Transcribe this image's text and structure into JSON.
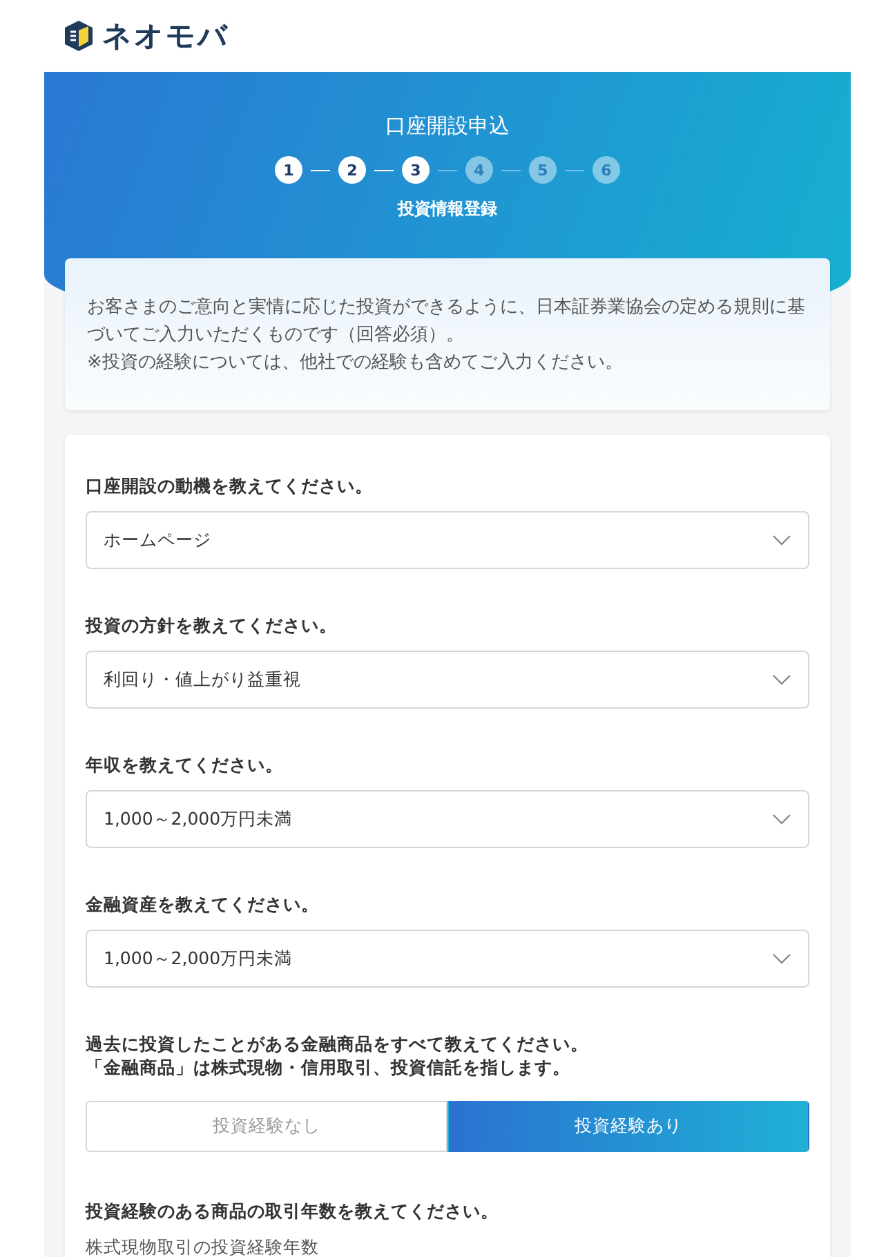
{
  "header": {
    "logo_text": "ネオモバ"
  },
  "hero": {
    "title": "口座開設申込",
    "steps": [
      {
        "label": "1",
        "done": true
      },
      {
        "label": "2",
        "done": true
      },
      {
        "label": "3",
        "done": true
      },
      {
        "label": "4",
        "done": false
      },
      {
        "label": "5",
        "done": false
      },
      {
        "label": "6",
        "done": false
      }
    ],
    "subtitle": "投資情報登録"
  },
  "notice": {
    "lines": [
      "お客さまのご意向と実情に応じた投資ができるように、日本証券業協会の定める規則に基づいてご入力いただくものです（回答必須）。",
      "※投資の経験については、他社での経験も含めてご入力ください。"
    ]
  },
  "form": {
    "questions": [
      {
        "label": "口座開設の動機を教えてください。",
        "value": "ホームページ"
      },
      {
        "label": "投資の方針を教えてください。",
        "value": "利回り・値上がり益重視"
      },
      {
        "label": "年収を教えてください。",
        "value": "1,000～2,000万円未満"
      },
      {
        "label": "金融資産を教えてください。",
        "value": "1,000～2,000万円未満"
      }
    ],
    "experience": {
      "label_lines": [
        "過去に投資したことがある金融商品をすべて教えてください。",
        "「金融商品」は株式現物・信用取引、投資信託を指します。"
      ],
      "options": [
        {
          "label": "投資経験なし",
          "selected": false
        },
        {
          "label": "投資経験あり",
          "selected": true
        }
      ]
    },
    "years": {
      "label": "投資経験のある商品の取引年数を教えてください。",
      "sublabel": "株式現物取引の投資経験年数"
    }
  }
}
